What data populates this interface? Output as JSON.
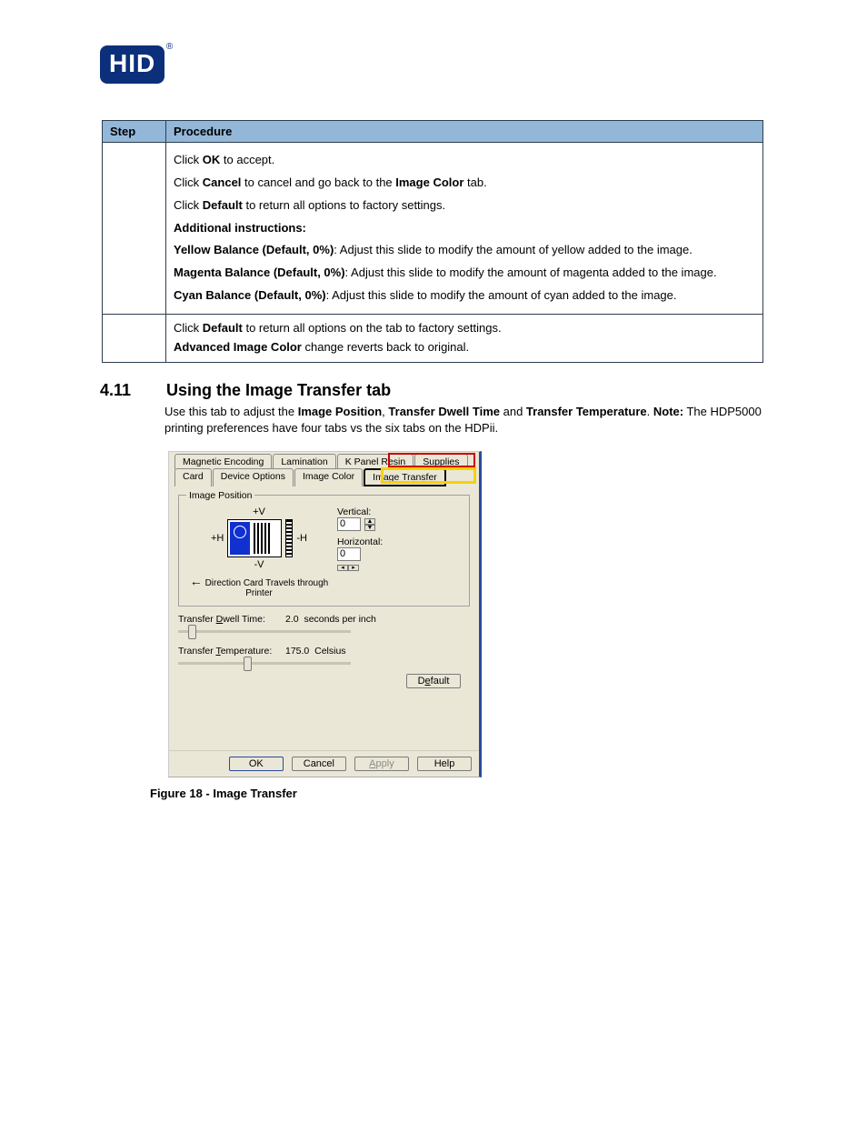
{
  "logo": {
    "text": "HID",
    "reg": "®"
  },
  "table": {
    "headers": {
      "step": "Step",
      "procedure": "Procedure"
    },
    "row1": {
      "line1_pre": "Click ",
      "line1_b": "OK",
      "line1_post": " to accept.",
      "line2_pre": "Click ",
      "line2_b": "Cancel",
      "line2_mid": " to cancel and go back to the ",
      "line2_b2": "Image Color",
      "line2_post": " tab.",
      "line3_pre": "Click ",
      "line3_b": "Default",
      "line3_post": " to return all options to factory settings.",
      "line4_b": "Additional instructions:",
      "line5_b": "Yellow Balance (Default, 0%)",
      "line5_post": ": Adjust this slide to modify the amount of yellow added to the image.",
      "line6_b": "Magenta Balance (Default, 0%)",
      "line6_post": ": Adjust this slide to modify the amount of magenta added to the image.",
      "line7_b": "Cyan Balance (Default, 0%)",
      "line7_post": ": Adjust this slide to modify the amount of cyan added to the image."
    },
    "row2": {
      "line1_pre": "Click ",
      "line1_b": "Default",
      "line1_post": " to return all options on the tab to factory settings.",
      "line2_b": "Advanced Image Color",
      "line2_post": " change reverts back to original."
    }
  },
  "heading": {
    "num": "4.11",
    "title": "Using the Image Transfer tab"
  },
  "intro": {
    "pre": "Use this tab to adjust the ",
    "b1": "Image Position",
    "mid1": ", ",
    "b2": "Transfer Dwell Time",
    "mid2": " and ",
    "b3": "Transfer Temperature",
    "post": ". ",
    "note_b": "Note:",
    "note_post": " The HDP5000 printing preferences have four tabs vs the six tabs on the HDPii."
  },
  "dialog": {
    "tabs_row1": [
      "Magnetic Encoding",
      "Lamination",
      "K Panel Resin",
      "Supplies"
    ],
    "tabs_row2": [
      "Card",
      "Device Options",
      "Image Color",
      "Image Transfer"
    ],
    "image_position": {
      "legend": "Image Position",
      "plusV": "+V",
      "minusV": "-V",
      "plusH": "+H",
      "minusH": "-H",
      "direction": "Direction Card Travels through Printer",
      "vertical_label": "Vertical:",
      "vertical_value": "0",
      "horizontal_label": "Horizontal:",
      "horizontal_value": "0"
    },
    "dwell": {
      "label_pre": "Transfer ",
      "label_u": "D",
      "label_post": "well Time:",
      "value": "2.0",
      "unit": "seconds per inch",
      "thumb_pct": 6
    },
    "temp": {
      "label_pre": "Transfer ",
      "label_u": "T",
      "label_post": "emperature:",
      "value": "175.0",
      "unit": "Celsius",
      "thumb_pct": 38
    },
    "default_btn": "Default",
    "default_u": "e",
    "buttons": {
      "ok": "OK",
      "cancel": "Cancel",
      "apply": "Apply",
      "apply_u": "A",
      "help": "Help"
    }
  },
  "figure_caption": "Figure 18 - Image Transfer"
}
